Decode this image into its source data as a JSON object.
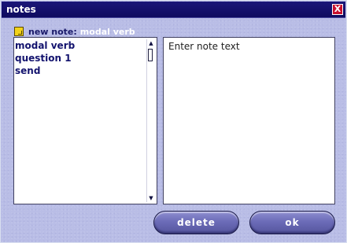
{
  "window": {
    "title": "notes",
    "close_label": "X"
  },
  "new_note": {
    "label": "new note:",
    "value": "modal verb"
  },
  "notes_list": {
    "items": [
      {
        "label": "modal verb"
      },
      {
        "label": "question 1"
      },
      {
        "label": "send"
      }
    ]
  },
  "editor": {
    "text": "Enter note text"
  },
  "buttons": {
    "delete_label": "delete",
    "ok_label": "ok"
  },
  "scrollbar": {
    "up_arrow": "▲",
    "down_arrow": "▼"
  },
  "icons": {
    "note": "note-icon",
    "close": "close-icon"
  },
  "colors": {
    "titlebar": "#120e66",
    "window_bg": "#b9bde6",
    "list_text": "#13136e",
    "button": "#6c6cb8",
    "note_icon": "#f2d21a",
    "close_button": "#c8102e"
  }
}
